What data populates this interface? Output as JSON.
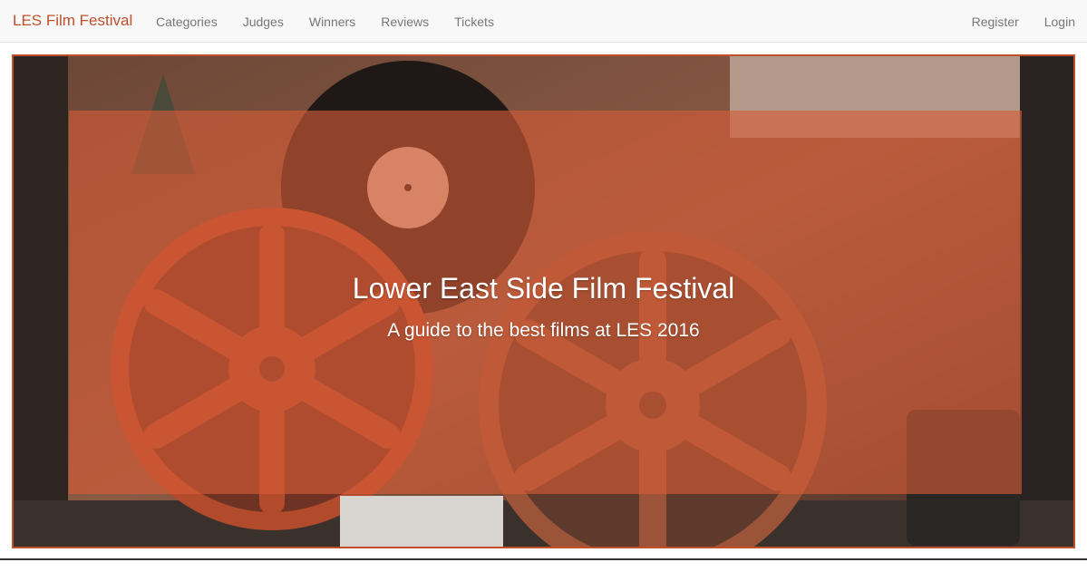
{
  "navbar": {
    "brand": "LES Film Festival",
    "left_items": [
      "Categories",
      "Judges",
      "Winners",
      "Reviews",
      "Tickets"
    ],
    "right_items": [
      "Register",
      "Login"
    ]
  },
  "hero": {
    "title": "Lower East Side Film Festival",
    "subtitle": "A guide to the best films at LES 2016",
    "image_icon": "film-reels-photo",
    "overlay_color": "#d65c37",
    "border_color": "#c0502c"
  },
  "colors": {
    "brand": "#c0502c",
    "nav_text": "#777777",
    "nav_bg": "#f8f8f8"
  }
}
